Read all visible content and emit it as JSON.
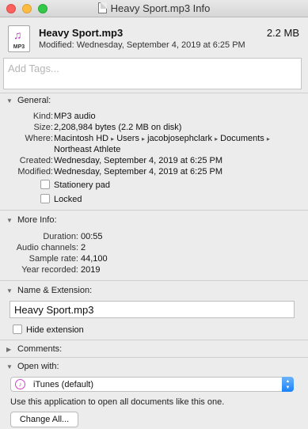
{
  "window": {
    "title": "Heavy Sport.mp3 Info"
  },
  "header": {
    "file_name": "Heavy Sport.mp3",
    "file_size": "2.2 MB",
    "modified": "Modified: Wednesday, September 4, 2019 at 6:25 PM",
    "icon_ext": "MP3"
  },
  "tags": {
    "placeholder": "Add Tags..."
  },
  "general": {
    "title": "General:",
    "kind": {
      "label": "Kind:",
      "value": "MP3 audio"
    },
    "size": {
      "label": "Size:",
      "value": "2,208,984 bytes (2.2 MB on disk)"
    },
    "where": {
      "label": "Where:",
      "path": [
        "Macintosh HD",
        "Users",
        "jacobjosephclark",
        "Documents"
      ],
      "path_sep": "▸",
      "path_last": "Northeast Athlete"
    },
    "created": {
      "label": "Created:",
      "value": "Wednesday, September 4, 2019 at 6:25 PM"
    },
    "modified": {
      "label": "Modified:",
      "value": "Wednesday, September 4, 2019 at 6:25 PM"
    },
    "stationery_pad": "Stationery pad",
    "locked": "Locked"
  },
  "more_info": {
    "title": "More Info:",
    "duration": {
      "label": "Duration:",
      "value": "00:55"
    },
    "audio_channels": {
      "label": "Audio channels:",
      "value": "2"
    },
    "sample_rate": {
      "label": "Sample rate:",
      "value": "44,100"
    },
    "year_recorded": {
      "label": "Year recorded:",
      "value": "2019"
    }
  },
  "name_extension": {
    "title": "Name & Extension:",
    "value": "Heavy Sport.mp3",
    "hide_extension": "Hide extension"
  },
  "comments": {
    "title": "Comments:"
  },
  "open_with": {
    "title": "Open with:",
    "app": "iTunes (default)",
    "hint": "Use this application to open all documents like this one.",
    "change_all": "Change All..."
  },
  "icons": {
    "expanded": "▼",
    "collapsed": "▶"
  },
  "colors": {
    "accent": "#1a82fb",
    "itunes": "#d143c7"
  }
}
